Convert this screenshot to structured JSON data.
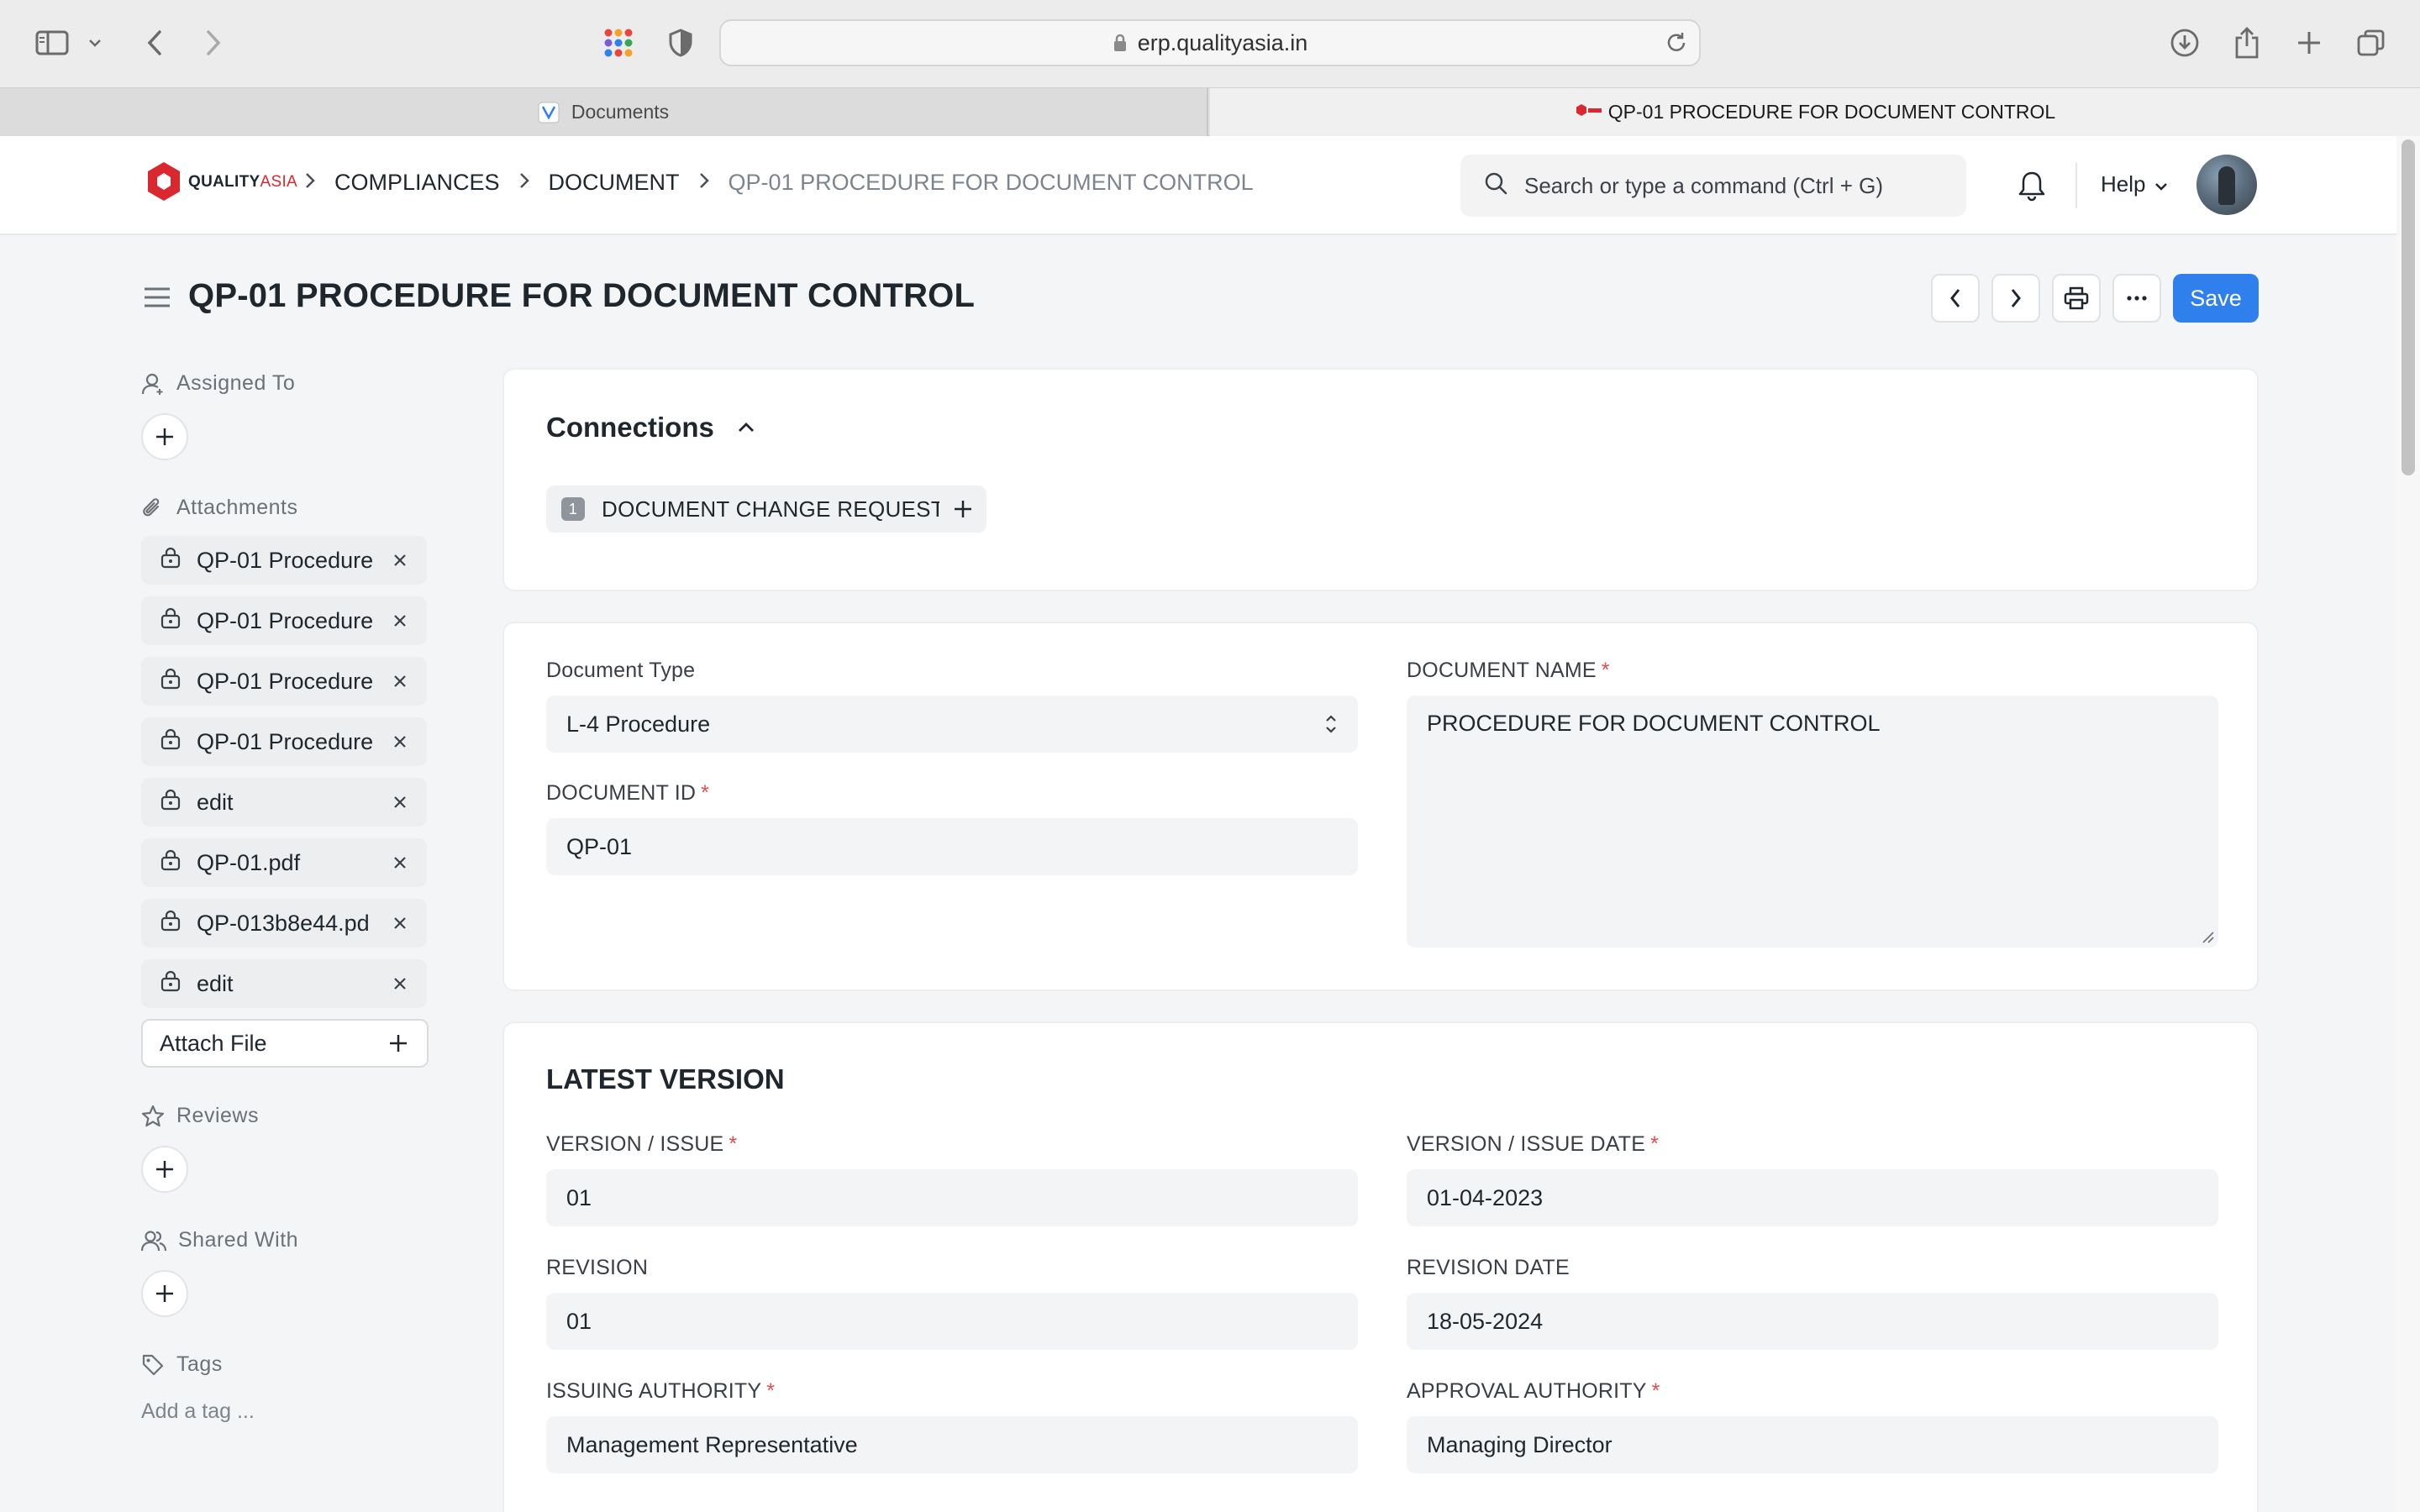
{
  "browser": {
    "url": "erp.qualityasia.in",
    "tabs": [
      {
        "label": "Documents"
      },
      {
        "label": "QP-01 PROCEDURE FOR DOCUMENT CONTROL"
      }
    ]
  },
  "navbar": {
    "logo": {
      "text_main": "QUALITY",
      "text_accent": "ASIA",
      "brand_color": "#d9282f"
    },
    "breadcrumbs": [
      "COMPLIANCES",
      "DOCUMENT",
      "QP-01 PROCEDURE FOR DOCUMENT CONTROL"
    ],
    "search_placeholder": "Search or type a command (Ctrl + G)",
    "help_label": "Help"
  },
  "page": {
    "title": "QP-01 PROCEDURE FOR DOCUMENT CONTROL",
    "save_label": "Save",
    "accent_color": "#2f80ed"
  },
  "sidebar": {
    "assigned_to_label": "Assigned To",
    "attachments_label": "Attachments",
    "attachments": [
      {
        "name": "QP-01 Procedure"
      },
      {
        "name": "QP-01 Procedure"
      },
      {
        "name": "QP-01 Procedure"
      },
      {
        "name": "QP-01 Procedure"
      },
      {
        "name": "edit"
      },
      {
        "name": "QP-01.pdf"
      },
      {
        "name": "QP-013b8e44.pd"
      },
      {
        "name": "edit"
      }
    ],
    "attach_file_label": "Attach File",
    "reviews_label": "Reviews",
    "shared_with_label": "Shared With",
    "tags_label": "Tags",
    "add_tag_label": "Add a tag ..."
  },
  "connections": {
    "title": "Connections",
    "items": [
      {
        "count": "1",
        "label": "DOCUMENT CHANGE REQUEST"
      }
    ]
  },
  "document": {
    "document_type_label": "Document Type",
    "document_type_value": "L-4 Procedure",
    "document_id_label": "DOCUMENT ID",
    "document_id_value": "QP-01",
    "document_name_label": "DOCUMENT NAME",
    "document_name_value": "PROCEDURE FOR DOCUMENT CONTROL"
  },
  "latest_version": {
    "title": "LATEST VERSION",
    "version_label": "VERSION / ISSUE",
    "version_value": "01",
    "version_date_label": "VERSION / ISSUE DATE",
    "version_date_value": "01-04-2023",
    "revision_label": "REVISION",
    "revision_value": "01",
    "revision_date_label": "REVISION DATE",
    "revision_date_value": "18-05-2024",
    "issuing_authority_label": "ISSUING AUTHORITY",
    "issuing_authority_value": "Management Representative",
    "approval_authority_label": "APPROVAL AUTHORITY",
    "approval_authority_value": "Managing Director"
  }
}
